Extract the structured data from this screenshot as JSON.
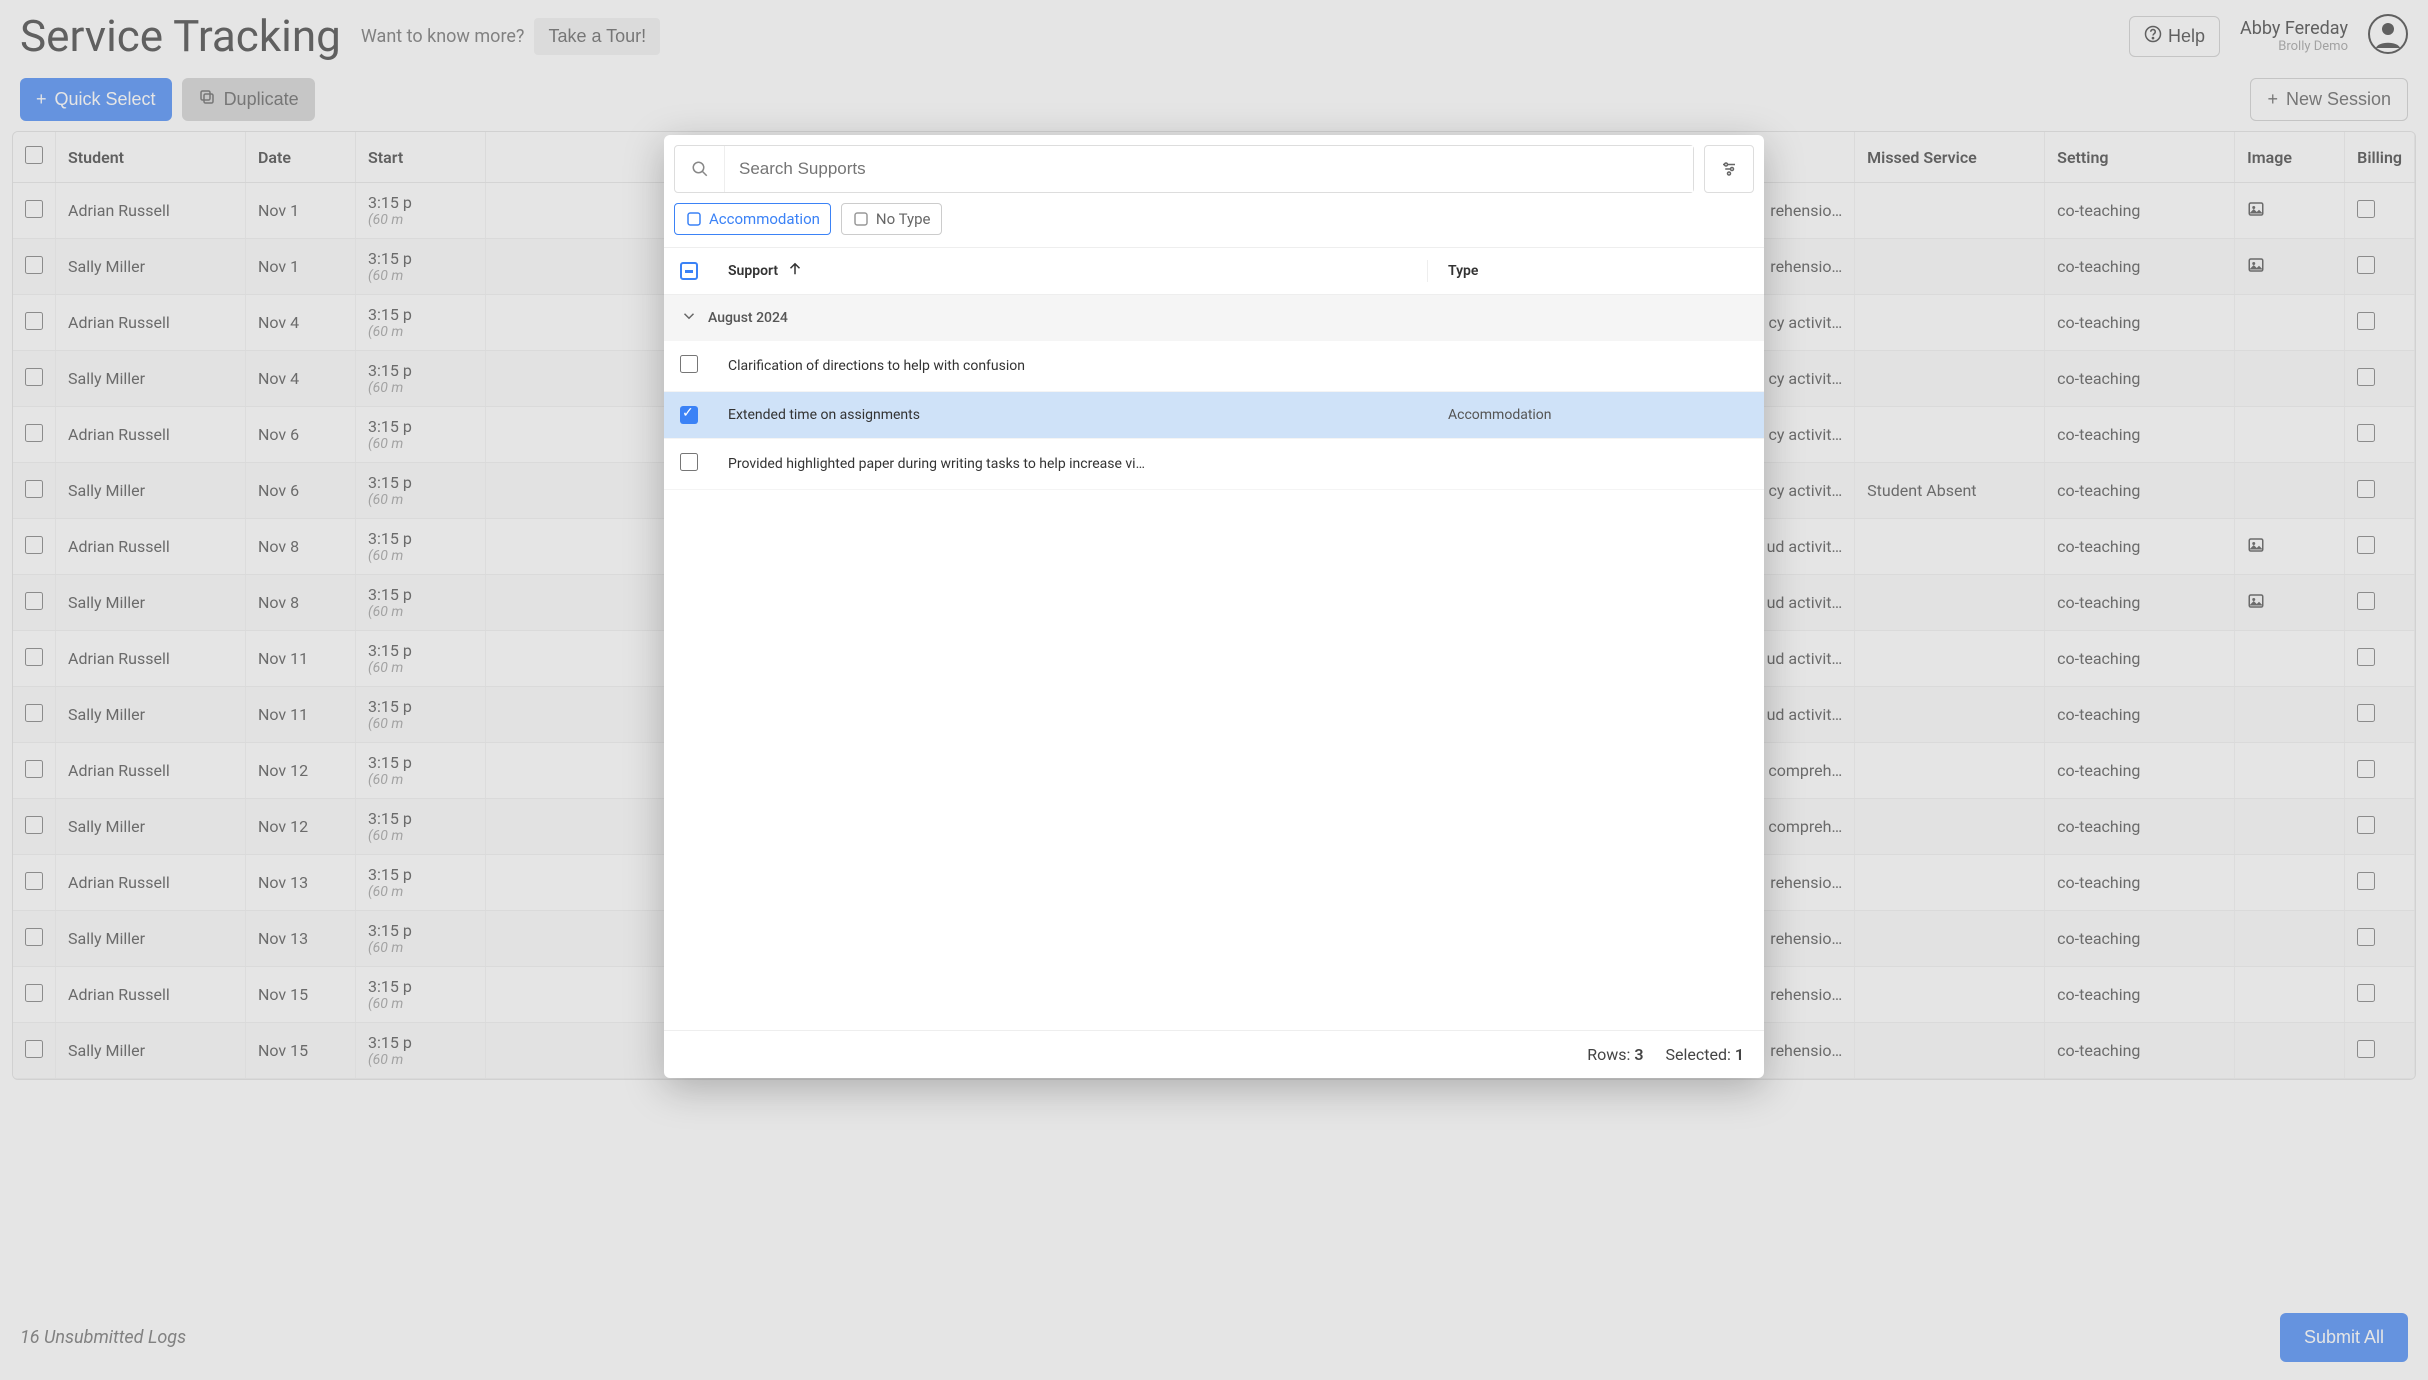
{
  "header": {
    "title": "Service Tracking",
    "want_more": "Want to know more?",
    "tour_btn": "Take a Tour!",
    "help_btn": "Help",
    "user_name": "Abby Fereday",
    "user_sub": "Brolly Demo"
  },
  "actions": {
    "quick_select": "Quick Select",
    "duplicate": "Duplicate",
    "new_session": "New Session"
  },
  "columns": {
    "student": "Student",
    "date": "Date",
    "start": "Start",
    "missed": "Missed Service",
    "setting": "Setting",
    "image": "Image",
    "billing": "Billing"
  },
  "rows": [
    {
      "student": "Adrian Russell",
      "date": "Nov 1",
      "time": "3:15 p",
      "dur": "(60 m",
      "notes": "rehensio…",
      "missed": "",
      "setting": "co-teaching",
      "img": true
    },
    {
      "student": "Sally Miller",
      "date": "Nov 1",
      "time": "3:15 p",
      "dur": "(60 m",
      "notes": "rehensio…",
      "missed": "",
      "setting": "co-teaching",
      "img": true
    },
    {
      "student": "Adrian Russell",
      "date": "Nov 4",
      "time": "3:15 p",
      "dur": "(60 m",
      "notes": "cy activit…",
      "missed": "",
      "setting": "co-teaching",
      "img": false
    },
    {
      "student": "Sally Miller",
      "date": "Nov 4",
      "time": "3:15 p",
      "dur": "(60 m",
      "notes": "cy activit…",
      "missed": "",
      "setting": "co-teaching",
      "img": false
    },
    {
      "student": "Adrian Russell",
      "date": "Nov 6",
      "time": "3:15 p",
      "dur": "(60 m",
      "notes": "cy activit…",
      "missed": "",
      "setting": "co-teaching",
      "img": false
    },
    {
      "student": "Sally Miller",
      "date": "Nov 6",
      "time": "3:15 p",
      "dur": "(60 m",
      "notes": "cy activit…",
      "missed": "Student Absent",
      "setting": "co-teaching",
      "img": false
    },
    {
      "student": "Adrian Russell",
      "date": "Nov 8",
      "time": "3:15 p",
      "dur": "(60 m",
      "notes": "ud activit…",
      "missed": "",
      "setting": "co-teaching",
      "img": true
    },
    {
      "student": "Sally Miller",
      "date": "Nov 8",
      "time": "3:15 p",
      "dur": "(60 m",
      "notes": "ud activit…",
      "missed": "",
      "setting": "co-teaching",
      "img": true
    },
    {
      "student": "Adrian Russell",
      "date": "Nov 11",
      "time": "3:15 p",
      "dur": "(60 m",
      "notes": "ud activit…",
      "missed": "",
      "setting": "co-teaching",
      "img": false
    },
    {
      "student": "Sally Miller",
      "date": "Nov 11",
      "time": "3:15 p",
      "dur": "(60 m",
      "notes": "ud activit…",
      "missed": "",
      "setting": "co-teaching",
      "img": false
    },
    {
      "student": "Adrian Russell",
      "date": "Nov 12",
      "time": "3:15 p",
      "dur": "(60 m",
      "notes": "compreh…",
      "missed": "",
      "setting": "co-teaching",
      "img": false
    },
    {
      "student": "Sally Miller",
      "date": "Nov 12",
      "time": "3:15 p",
      "dur": "(60 m",
      "notes": "compreh…",
      "missed": "",
      "setting": "co-teaching",
      "img": false
    },
    {
      "student": "Adrian Russell",
      "date": "Nov 13",
      "time": "3:15 p",
      "dur": "(60 m",
      "notes": "rehensio…",
      "missed": "",
      "setting": "co-teaching",
      "img": false
    },
    {
      "student": "Sally Miller",
      "date": "Nov 13",
      "time": "3:15 p",
      "dur": "(60 m",
      "notes": "rehensio…",
      "missed": "",
      "setting": "co-teaching",
      "img": false
    },
    {
      "student": "Adrian Russell",
      "date": "Nov 15",
      "time": "3:15 p",
      "dur": "(60 m",
      "notes": "rehensio…",
      "missed": "",
      "setting": "co-teaching",
      "img": false
    },
    {
      "student": "Sally Miller",
      "date": "Nov 15",
      "time": "3:15 p",
      "dur": "(60 m",
      "notes": "rehensio…",
      "missed": "",
      "setting": "co-teaching",
      "img": false
    }
  ],
  "footer": {
    "unsubmitted": "16 Unsubmitted Logs",
    "submit_all": "Submit All"
  },
  "modal": {
    "search_placeholder": "Search Supports",
    "chip_accommodation": "Accommodation",
    "chip_notype": "No Type",
    "col_support": "Support",
    "col_type": "Type",
    "group": "August 2024",
    "items": [
      {
        "name": "Clarification of directions to help with confusion",
        "type": "",
        "checked": false
      },
      {
        "name": "Extended time on assignments",
        "type": "Accommodation",
        "checked": true
      },
      {
        "name": "Provided highlighted paper during writing tasks to help increase vi…",
        "type": "",
        "checked": false
      }
    ],
    "rows_label": "Rows:",
    "rows_count": "3",
    "selected_label": "Selected:",
    "selected_count": "1"
  }
}
